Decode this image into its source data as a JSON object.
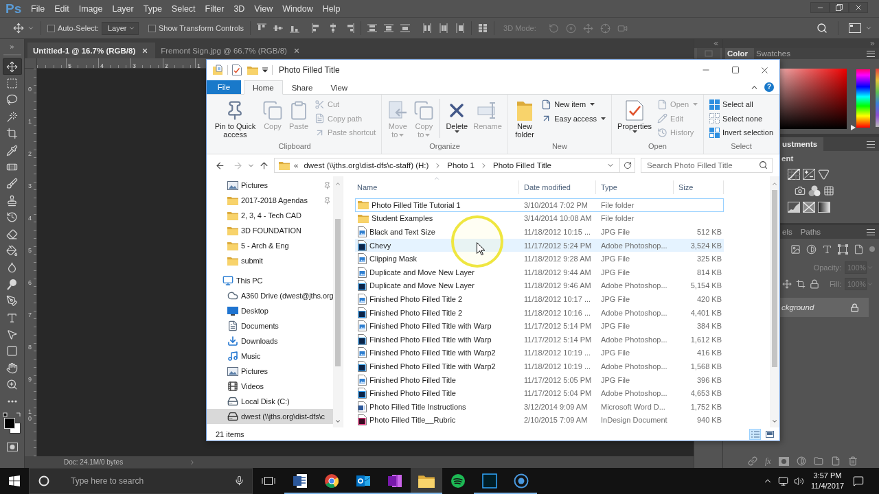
{
  "photoshop": {
    "logo": "Ps",
    "menu": [
      "File",
      "Edit",
      "Image",
      "Layer",
      "Type",
      "Select",
      "Filter",
      "3D",
      "View",
      "Window",
      "Help"
    ],
    "options": {
      "auto_select": {
        "label": "Auto-Select:",
        "checked": false
      },
      "target": "Layer",
      "transform": {
        "label": "Show Transform Controls",
        "checked": false
      },
      "mode_3d": "3D Mode:"
    },
    "doc_tabs": [
      {
        "title": "Untitled-1 @ 16.7% (RGB/8)",
        "selected": true
      },
      {
        "title": "Fremont Sign.jpg @ 66.7% (RGB/8)",
        "selected": false
      }
    ],
    "ruler": [
      "5",
      "4",
      "3",
      "2",
      "1"
    ],
    "ruler_vertical": [
      "0",
      "1",
      "2",
      "3",
      "4",
      "5",
      "6",
      "7",
      "8",
      "9",
      "10"
    ],
    "tools": [
      {
        "kind": "move",
        "selected": true
      },
      {
        "kind": "marquee",
        "selected": false
      },
      {
        "kind": "lasso",
        "selected": false
      },
      {
        "kind": "wand",
        "selected": false
      },
      {
        "kind": "crop",
        "selected": false
      },
      {
        "kind": "eyedropper",
        "selected": false
      },
      {
        "kind": "healing",
        "selected": false
      },
      {
        "kind": "brush",
        "selected": false
      },
      {
        "kind": "stamp",
        "selected": false
      },
      {
        "kind": "history",
        "selected": false
      },
      {
        "kind": "eraser",
        "selected": false
      },
      {
        "kind": "bucket",
        "selected": false
      },
      {
        "kind": "blur",
        "selected": false
      },
      {
        "kind": "dodge",
        "selected": false
      },
      {
        "kind": "pen",
        "selected": false
      },
      {
        "kind": "type",
        "selected": false
      },
      {
        "kind": "path",
        "selected": false
      },
      {
        "kind": "shape",
        "selected": false
      },
      {
        "kind": "hand",
        "selected": false
      },
      {
        "kind": "zoom",
        "selected": false
      },
      {
        "kind": "more",
        "selected": false
      }
    ],
    "status": "Doc: 24.1M/0 bytes",
    "color_panel": {
      "tabs": [
        {
          "label": "Color",
          "selected": true
        },
        {
          "label": "Swatches",
          "selected": false
        }
      ],
      "hue_slider": {
        "level": 0
      }
    },
    "adjustments_panel": {
      "tabs": [
        {
          "label": "ustments",
          "selected": true
        }
      ],
      "heading": "ent"
    },
    "layers_panel": {
      "tabs": [
        {
          "label": "els",
          "selected": false
        },
        {
          "label": "Paths",
          "selected": false
        }
      ],
      "opacity_label": "Opacity:",
      "opacity": "100%",
      "fill_label": "Fill:",
      "fill": "100%",
      "layers": [
        {
          "name": "ckground",
          "locked": true,
          "selected": true
        }
      ],
      "style_button": "fx"
    }
  },
  "explorer": {
    "title": "Photo Filled Title",
    "ribbon_tabs": [
      {
        "label": "File",
        "kind": "backstage",
        "selected": false
      },
      {
        "label": "Home",
        "kind": "tab",
        "selected": true
      },
      {
        "label": "Share",
        "kind": "tab",
        "selected": false
      },
      {
        "label": "View",
        "kind": "tab",
        "selected": false
      }
    ],
    "help_button": "?",
    "ribbon_groups": [
      {
        "label": "Clipboard",
        "large": [
          {
            "kind": "pin",
            "label": "Pin to Quick access",
            "disabled": false,
            "dropdown": false
          },
          {
            "kind": "copy",
            "label": "Copy",
            "disabled": true,
            "dropdown": false
          },
          {
            "kind": "paste",
            "label": "Paste",
            "disabled": true,
            "dropdown": false
          }
        ],
        "small": [
          {
            "kind": "cut",
            "label": "Cut",
            "disabled": true,
            "dropdown": false
          },
          {
            "kind": "copy-path",
            "label": "Copy path",
            "disabled": true,
            "dropdown": false
          },
          {
            "kind": "paste-shortcut",
            "label": "Paste shortcut",
            "disabled": true,
            "dropdown": false
          }
        ]
      },
      {
        "label": "Organize",
        "large": [
          {
            "kind": "move-to",
            "label": "Move to",
            "disabled": true,
            "dropdown": true
          },
          {
            "kind": "copy-to",
            "label": "Copy to",
            "disabled": true,
            "dropdown": true
          },
          {
            "kind": "delete",
            "label": "Delete",
            "disabled": false,
            "dropdown": true,
            "divider_before": true
          },
          {
            "kind": "rename",
            "label": "Rename",
            "disabled": true,
            "dropdown": false
          }
        ]
      },
      {
        "label": "New",
        "large": [
          {
            "kind": "new-folder",
            "label": "New folder",
            "disabled": false,
            "dropdown": false
          }
        ],
        "small": [
          {
            "kind": "new-item",
            "label": "New item",
            "disabled": false,
            "dropdown": true
          },
          {
            "kind": "easy-access",
            "label": "Easy access",
            "disabled": false,
            "dropdown": true
          }
        ]
      },
      {
        "label": "Open",
        "large": [
          {
            "kind": "properties",
            "label": "Properties",
            "disabled": false,
            "dropdown": true
          }
        ],
        "small": [
          {
            "kind": "open",
            "label": "Open",
            "disabled": true,
            "dropdown": true
          },
          {
            "kind": "edit",
            "label": "Edit",
            "disabled": true,
            "dropdown": false
          },
          {
            "kind": "history",
            "label": "History",
            "disabled": true,
            "dropdown": false
          }
        ]
      },
      {
        "label": "Select",
        "small": [
          {
            "kind": "select-all",
            "label": "Select all",
            "disabled": false,
            "dropdown": false
          },
          {
            "kind": "select-none",
            "label": "Select none",
            "disabled": false,
            "dropdown": false
          },
          {
            "kind": "invert-selection",
            "label": "Invert selection",
            "disabled": false,
            "dropdown": false
          }
        ]
      }
    ],
    "address": {
      "overflow": "«",
      "crumbs": [
        "dwest (\\\\jths.org\\dist-dfs\\c-staff) (H:)",
        "Photo 1",
        "Photo Filled Title"
      ]
    },
    "search": {
      "placeholder": "Search Photo Filled Title"
    },
    "nav": {
      "quick_access": [
        {
          "kind": "pictures",
          "label": "Pictures",
          "pinned": true,
          "selected": false
        },
        {
          "kind": "folder",
          "label": "2017-2018 Agendas",
          "pinned": true,
          "selected": false
        },
        {
          "kind": "folder",
          "label": "2, 3, 4 - Tech CAD",
          "pinned": false,
          "selected": false
        },
        {
          "kind": "folder",
          "label": "3D FOUNDATION",
          "pinned": false,
          "selected": false
        },
        {
          "kind": "folder",
          "label": "5 - Arch & Eng",
          "pinned": false,
          "selected": false
        },
        {
          "kind": "folder",
          "label": "submit",
          "pinned": false,
          "selected": false
        }
      ],
      "tree": [
        {
          "kind": "computer",
          "label": "This PC",
          "selected": false,
          "children": [
            {
              "kind": "cloud",
              "label": "A360 Drive (dwest@jths.org",
              "selected": false
            },
            {
              "kind": "desktop",
              "label": "Desktop",
              "selected": false
            },
            {
              "kind": "documents",
              "label": "Documents",
              "selected": false
            },
            {
              "kind": "downloads",
              "label": "Downloads",
              "selected": false
            },
            {
              "kind": "music",
              "label": "Music",
              "selected": false
            },
            {
              "kind": "pictures",
              "label": "Pictures",
              "selected": false
            },
            {
              "kind": "videos",
              "label": "Videos",
              "selected": false
            },
            {
              "kind": "disk",
              "label": "Local Disk (C:)",
              "selected": false
            },
            {
              "kind": "network-drive",
              "label": "dwest (\\\\jths.org\\dist-dfs\\c",
              "selected": true
            }
          ]
        }
      ]
    },
    "columns": [
      {
        "label": "Name",
        "sorted": true
      },
      {
        "label": "Date modified",
        "sorted": false
      },
      {
        "label": "Type",
        "sorted": false
      },
      {
        "label": "Size",
        "sorted": false
      }
    ],
    "files": [
      {
        "kind": "folder",
        "name": "Photo Filled Title Tutorial 1",
        "date": "3/10/2014 7:02 PM",
        "type": "File folder",
        "focused": true,
        "hovered": false
      },
      {
        "kind": "folder",
        "name": "Student Examples",
        "date": "3/14/2014 10:08 AM",
        "type": "File folder",
        "focused": false,
        "hovered": false
      },
      {
        "kind": "jpg",
        "name": "Black and Text Size",
        "date": "11/18/2012 10:15 ...",
        "type": "JPG File",
        "size": "512 KB",
        "focused": false,
        "hovered": false
      },
      {
        "kind": "psd",
        "name": "Chevy",
        "date": "11/17/2012 5:24 PM",
        "type": "Adobe Photoshop...",
        "size": "3,524 KB",
        "focused": false,
        "hovered": true
      },
      {
        "kind": "jpg",
        "name": "Clipping Mask",
        "date": "11/18/2012 9:28 AM",
        "type": "JPG File",
        "size": "325 KB",
        "focused": false,
        "hovered": false
      },
      {
        "kind": "jpg",
        "name": "Duplicate and Move New Layer",
        "date": "11/18/2012 9:44 AM",
        "type": "JPG File",
        "size": "814 KB",
        "focused": false,
        "hovered": false
      },
      {
        "kind": "psd",
        "name": "Duplicate and Move New Layer",
        "date": "11/18/2012 9:46 AM",
        "type": "Adobe Photoshop...",
        "size": "5,154 KB",
        "focused": false,
        "hovered": false
      },
      {
        "kind": "jpg",
        "name": "Finished Photo Filled Title 2",
        "date": "11/18/2012 10:17 ...",
        "type": "JPG File",
        "size": "420 KB",
        "focused": false,
        "hovered": false
      },
      {
        "kind": "psd",
        "name": "Finished Photo Filled Title 2",
        "date": "11/18/2012 10:16 ...",
        "type": "Adobe Photoshop...",
        "size": "4,401 KB",
        "focused": false,
        "hovered": false
      },
      {
        "kind": "jpg",
        "name": "Finished Photo Filled Title with Warp",
        "date": "11/17/2012 5:14 PM",
        "type": "JPG File",
        "size": "384 KB",
        "focused": false,
        "hovered": false
      },
      {
        "kind": "psd",
        "name": "Finished Photo Filled Title with Warp",
        "date": "11/17/2012 5:14 PM",
        "type": "Adobe Photoshop...",
        "size": "1,612 KB",
        "focused": false,
        "hovered": false
      },
      {
        "kind": "jpg",
        "name": "Finished Photo Filled Title with Warp2",
        "date": "11/18/2012 10:19 ...",
        "type": "JPG File",
        "size": "416 KB",
        "focused": false,
        "hovered": false
      },
      {
        "kind": "psd",
        "name": "Finished Photo Filled Title with Warp2",
        "date": "11/18/2012 10:19 ...",
        "type": "Adobe Photoshop...",
        "size": "1,568 KB",
        "focused": false,
        "hovered": false
      },
      {
        "kind": "jpg",
        "name": "Finished Photo Filled Title",
        "date": "11/17/2012 5:05 PM",
        "type": "JPG File",
        "size": "396 KB",
        "focused": false,
        "hovered": false
      },
      {
        "kind": "psd",
        "name": "Finished Photo Filled Title",
        "date": "11/17/2012 5:04 PM",
        "type": "Adobe Photoshop...",
        "size": "4,653 KB",
        "focused": false,
        "hovered": false
      },
      {
        "kind": "docx",
        "name": "Photo Filled Title Instructions",
        "date": "3/12/2014 9:09 AM",
        "type": "Microsoft Word D...",
        "size": "1,752 KB",
        "focused": false,
        "hovered": false
      },
      {
        "kind": "indd",
        "name": "Photo Filled Title__Rubric",
        "date": "2/10/2015 7:09 AM",
        "type": "InDesign Document",
        "size": "940 KB",
        "focused": false,
        "hovered": false
      }
    ],
    "status": "21 items",
    "views": [
      {
        "kind": "details",
        "selected": true
      },
      {
        "kind": "large-icons",
        "selected": false
      }
    ]
  },
  "taskbar": {
    "search": {
      "placeholder": "Type here to search"
    },
    "apps": [
      {
        "kind": "word",
        "running": true,
        "active": false
      },
      {
        "kind": "chrome",
        "running": true,
        "active": false
      },
      {
        "kind": "outlook",
        "running": true,
        "active": false
      },
      {
        "kind": "onenote",
        "running": true,
        "active": false
      },
      {
        "kind": "explorer",
        "running": true,
        "active": true
      },
      {
        "kind": "spotify",
        "running": false,
        "active": false
      },
      {
        "kind": "photoshop",
        "running": true,
        "active": false
      },
      {
        "kind": "recorder",
        "running": true,
        "active": false
      }
    ],
    "clock": {
      "time": "3:57 PM",
      "date": "11/4/2017"
    }
  }
}
